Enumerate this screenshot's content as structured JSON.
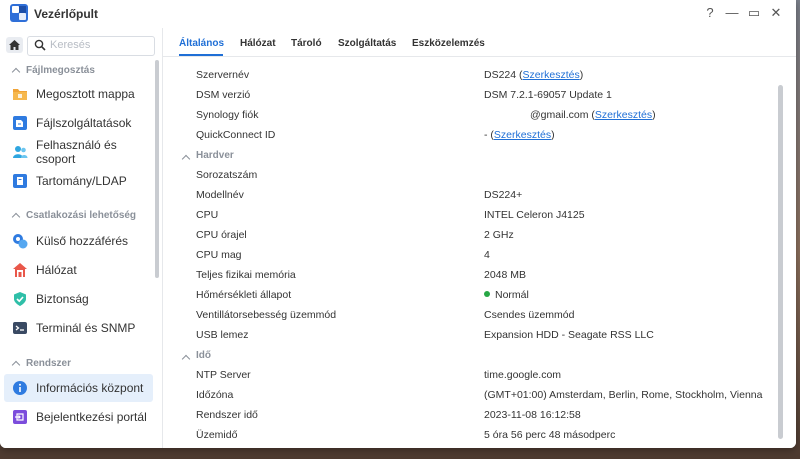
{
  "window": {
    "title": "Vezérlőpult",
    "controls": {
      "help": "?",
      "minimize": "—",
      "maximize": "▭",
      "close": "✕"
    }
  },
  "sidebar": {
    "search_placeholder": "Keresés",
    "sections": [
      {
        "header": "Fájlmegosztás",
        "items": [
          {
            "label": "Megosztott mappa",
            "icon": "shared-folder-icon"
          },
          {
            "label": "Fájlszolgáltatások",
            "icon": "file-services-icon"
          },
          {
            "label": "Felhasználó és csoport",
            "icon": "user-group-icon"
          },
          {
            "label": "Tartomány/LDAP",
            "icon": "domain-ldap-icon"
          }
        ]
      },
      {
        "header": "Csatlakozási lehetőség",
        "items": [
          {
            "label": "Külső hozzáférés",
            "icon": "external-access-icon"
          },
          {
            "label": "Hálózat",
            "icon": "network-icon"
          },
          {
            "label": "Biztonság",
            "icon": "security-icon"
          },
          {
            "label": "Terminál és SNMP",
            "icon": "terminal-icon"
          }
        ]
      },
      {
        "header": "Rendszer",
        "items": [
          {
            "label": "Információs központ",
            "icon": "info-center-icon",
            "active": true
          },
          {
            "label": "Bejelentkezési portál",
            "icon": "login-portal-icon"
          }
        ]
      }
    ]
  },
  "tabs": [
    {
      "label": "Általános",
      "active": true
    },
    {
      "label": "Hálózat"
    },
    {
      "label": "Tároló"
    },
    {
      "label": "Szolgáltatás"
    },
    {
      "label": "Eszközelemzés"
    }
  ],
  "general": {
    "edit_link": "Szerkesztés",
    "rows_top": [
      {
        "label": "Szervernév",
        "value": "DS224 (",
        "link": "Szerkesztés",
        "after": ")"
      },
      {
        "label": "DSM verzió",
        "value": "DSM 7.2.1-69057 Update 1"
      },
      {
        "label": "Synology fiók",
        "value": "@gmail.com (",
        "link": "Szerkesztés",
        "after": ")"
      },
      {
        "label": "QuickConnect ID",
        "value": "- (",
        "link": "Szerkesztés",
        "after": ")"
      }
    ],
    "hardware_header": "Hardver",
    "hardware": [
      {
        "label": "Sorozatszám",
        "value": ""
      },
      {
        "label": "Modellnév",
        "value": "DS224+"
      },
      {
        "label": "CPU",
        "value": "INTEL Celeron J4125"
      },
      {
        "label": "CPU órajel",
        "value": "2 GHz"
      },
      {
        "label": "CPU mag",
        "value": "4"
      },
      {
        "label": "Teljes fizikai memória",
        "value": "2048 MB"
      },
      {
        "label": "Hőmérsékleti állapot",
        "value": "Normál",
        "status_color": "#27a745"
      },
      {
        "label": "Ventillátorsebesség üzemmód",
        "value": "Csendes üzemmód"
      },
      {
        "label": "USB lemez",
        "value": "Expansion HDD - Seagate RSS LLC"
      }
    ],
    "time_header": "Idő",
    "time": [
      {
        "label": "NTP Server",
        "value": "time.google.com"
      },
      {
        "label": "Időzóna",
        "value": "(GMT+01:00) Amsterdam, Berlin, Rome, Stockholm, Vienna"
      },
      {
        "label": "Rendszer idő",
        "value": "2023-11-08 16:12:58"
      },
      {
        "label": "Üzemidő",
        "value": "5 óra 56 perc 48 másodperc"
      }
    ]
  },
  "colors": {
    "accent": "#1f6fd6",
    "ok": "#27a745"
  }
}
